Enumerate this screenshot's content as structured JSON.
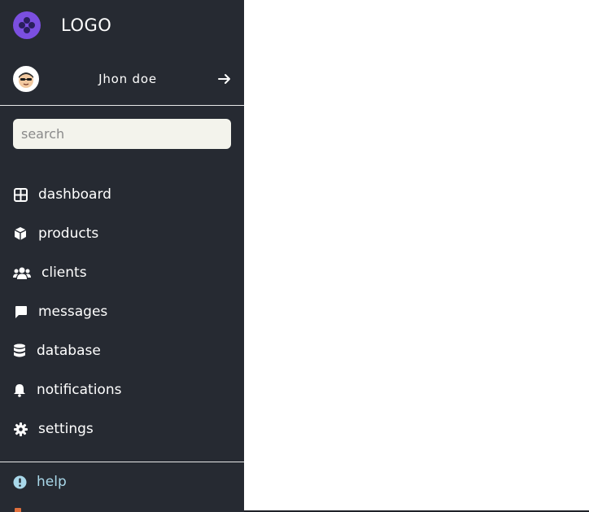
{
  "sidebar": {
    "logo_text": "LOGO",
    "user": {
      "name": "Jhon doe"
    },
    "search": {
      "placeholder": "search"
    },
    "items": [
      {
        "label": "dashboard",
        "icon": "grid-icon"
      },
      {
        "label": "products",
        "icon": "box-icon"
      },
      {
        "label": "clients",
        "icon": "users-icon"
      },
      {
        "label": "messages",
        "icon": "chat-icon"
      },
      {
        "label": "database",
        "icon": "database-icon"
      },
      {
        "label": "notifications",
        "icon": "bell-icon"
      },
      {
        "label": "settings",
        "icon": "gear-icon"
      }
    ],
    "help": {
      "label": "help",
      "icon": "alert-circle-icon"
    }
  },
  "colors": {
    "sidebar_bg": "#262a32",
    "logo_accent": "#7b4fe0",
    "help_text": "#a9d8ea",
    "search_bg": "#f3f3ec"
  }
}
